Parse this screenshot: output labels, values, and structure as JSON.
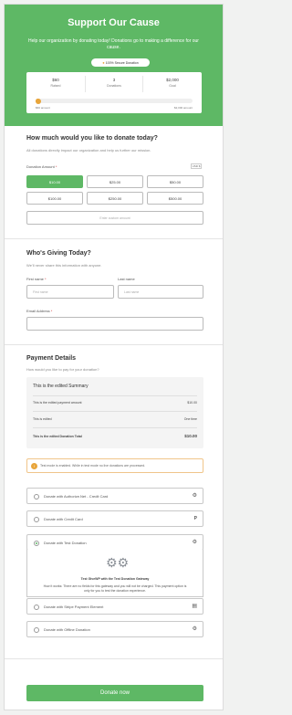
{
  "header": {
    "title": "Support Our Cause",
    "subtitle": "Help our organization by donating today! Donations go to making a difference for our cause.",
    "secure_badge": "100% Secure Donation",
    "stats": [
      {
        "value": "$60",
        "label": "Raised"
      },
      {
        "value": "3",
        "label": "Donations"
      },
      {
        "value": "$2,000",
        "label": "Goal"
      }
    ],
    "progress_fraction": 0.03,
    "progress_left_label": "$60 amount",
    "progress_right_label": "$2,000 amount"
  },
  "amount_section": {
    "title": "How much would you like to donate today?",
    "description": "All donations directly impact our organization and help us further our mission.",
    "field_label": "Donation Amount",
    "required_mark": "*",
    "currency_badge": "USD $",
    "options": [
      "$10.00",
      "$25.00",
      "$50.00",
      "$100.00",
      "$250.00",
      "$500.00"
    ],
    "selected_index": 0,
    "custom_placeholder": "Enter custom amount"
  },
  "donor_section": {
    "title": "Who's Giving Today?",
    "description": "We'll never share this information with anyone.",
    "first_name_label": "First name",
    "first_name_placeholder": "First name",
    "last_name_label": "Last name",
    "last_name_placeholder": "Last name",
    "email_label": "Email Address",
    "required_mark": "*"
  },
  "payment_section": {
    "title": "Payment Details",
    "description": "How would you like to pay for your donation?",
    "summary": {
      "title": "This is the edited Summary",
      "rows": [
        {
          "label": "This is the edited payment amount",
          "value": "$10.00"
        },
        {
          "label": "This is edited",
          "value": "One time"
        },
        {
          "label": "This is the edited Donation Total",
          "value": "$10.00"
        }
      ]
    },
    "notice": "Test mode is enabled. While in test mode no live donations are processed.",
    "gateways": [
      {
        "label": "Donate with Authorize.Net - Credit Card",
        "icon": "gear-icon"
      },
      {
        "label": "Donate with Credit Card",
        "icon": "paypal-icon"
      },
      {
        "label": "Donate with Test Donation",
        "icon": "gear-icon",
        "selected": true
      },
      {
        "label": "Donate with Stripe Payment Element",
        "icon": "card-icon"
      },
      {
        "label": "Donate with Offline Donation",
        "icon": "gear-icon"
      }
    ],
    "gateway_panel": {
      "title": "Test GiveWP with the Test Donation Gateway",
      "text": "How it works: There are no fields for this gateway and you will not be charged. This payment option is only for you to test the donation experience."
    }
  },
  "donate_button": "Donate now",
  "colors": {
    "accent": "#5eb865",
    "warning": "#e8a53b"
  }
}
